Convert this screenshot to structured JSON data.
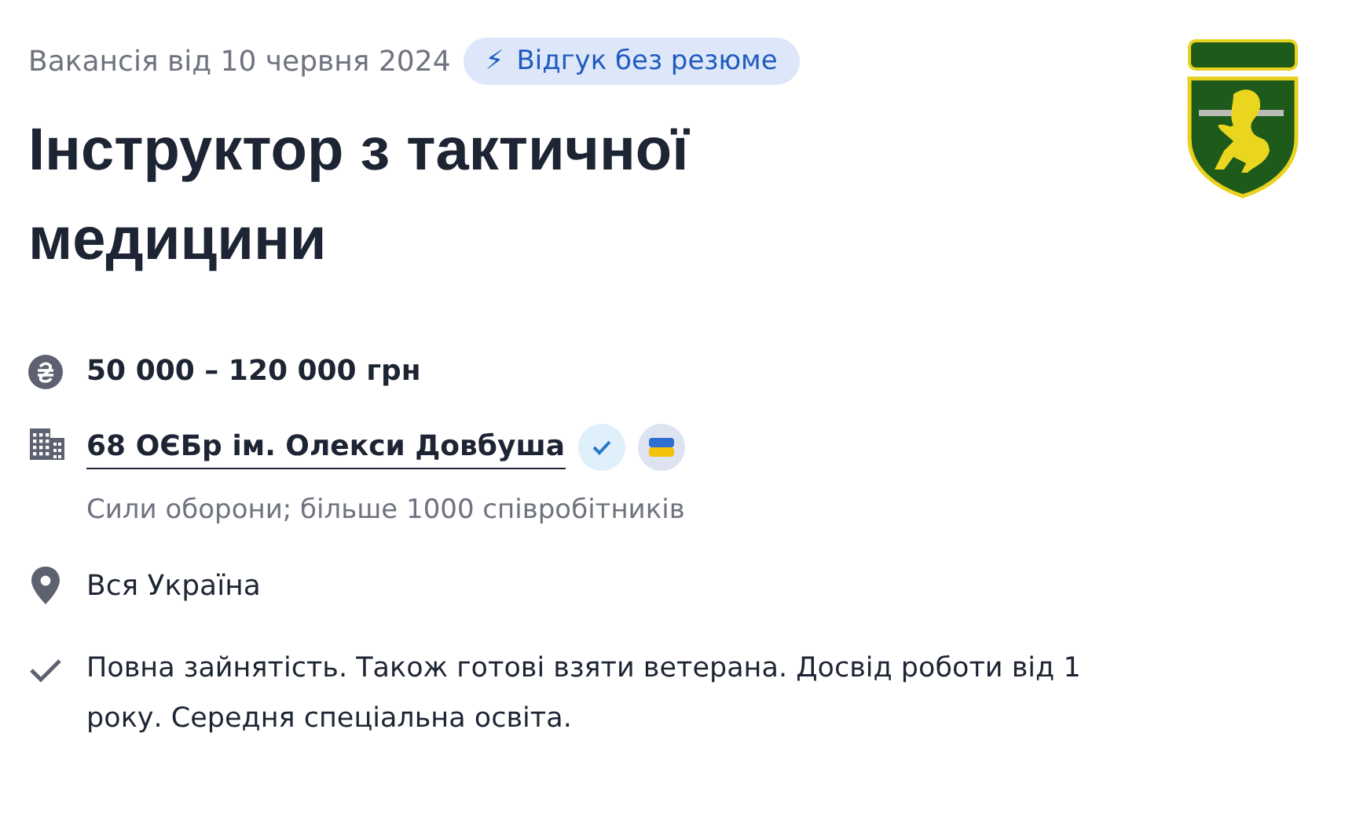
{
  "posted": "Вакансія від 10 червня 2024",
  "badge": {
    "icon": "⚡",
    "label": "Відгук без резюме"
  },
  "title": "Інструктор з тактичної медицини",
  "salary": "50 000 – 120 000 грн",
  "company": {
    "name": "68 ОЄБр ім. Олекси Довбуша",
    "verified": true,
    "flag": true,
    "description": "Сили оборони; більше 1000 співробітників"
  },
  "location": "Вся Україна",
  "details": "Повна зайнятість. Також готові взяти ветерана. Досвід роботи від 1 року. Середня спеціальна освіта."
}
